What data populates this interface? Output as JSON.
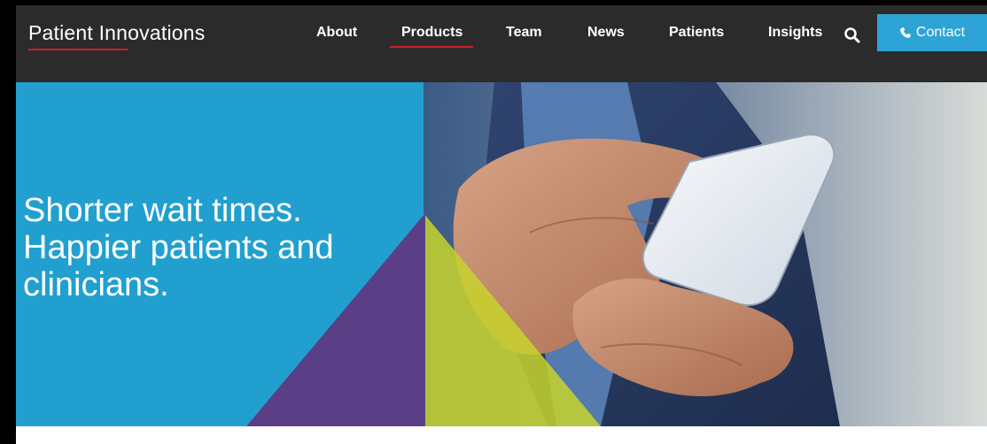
{
  "header": {
    "logo_text": "Patient Innovations",
    "nav": [
      {
        "label": "About"
      },
      {
        "label": "Products"
      },
      {
        "label": "Team"
      },
      {
        "label": "News"
      },
      {
        "label": "Patients"
      },
      {
        "label": "Insights"
      }
    ],
    "active_nav": "Products",
    "contact_label": "Contact",
    "search_icon": "search-icon",
    "phone_icon": "phone-icon"
  },
  "hero": {
    "headline_lines": [
      "Shorter wait times.",
      "Happier patients and",
      "clinicians."
    ]
  },
  "colors": {
    "nav_bg": "#2b2b2b",
    "accent_red": "#c8202f",
    "hero_blue": "#21a0d0",
    "contact_blue": "#2ea3d6",
    "purple": "#5b3f86",
    "lime": "#c7d42b"
  }
}
